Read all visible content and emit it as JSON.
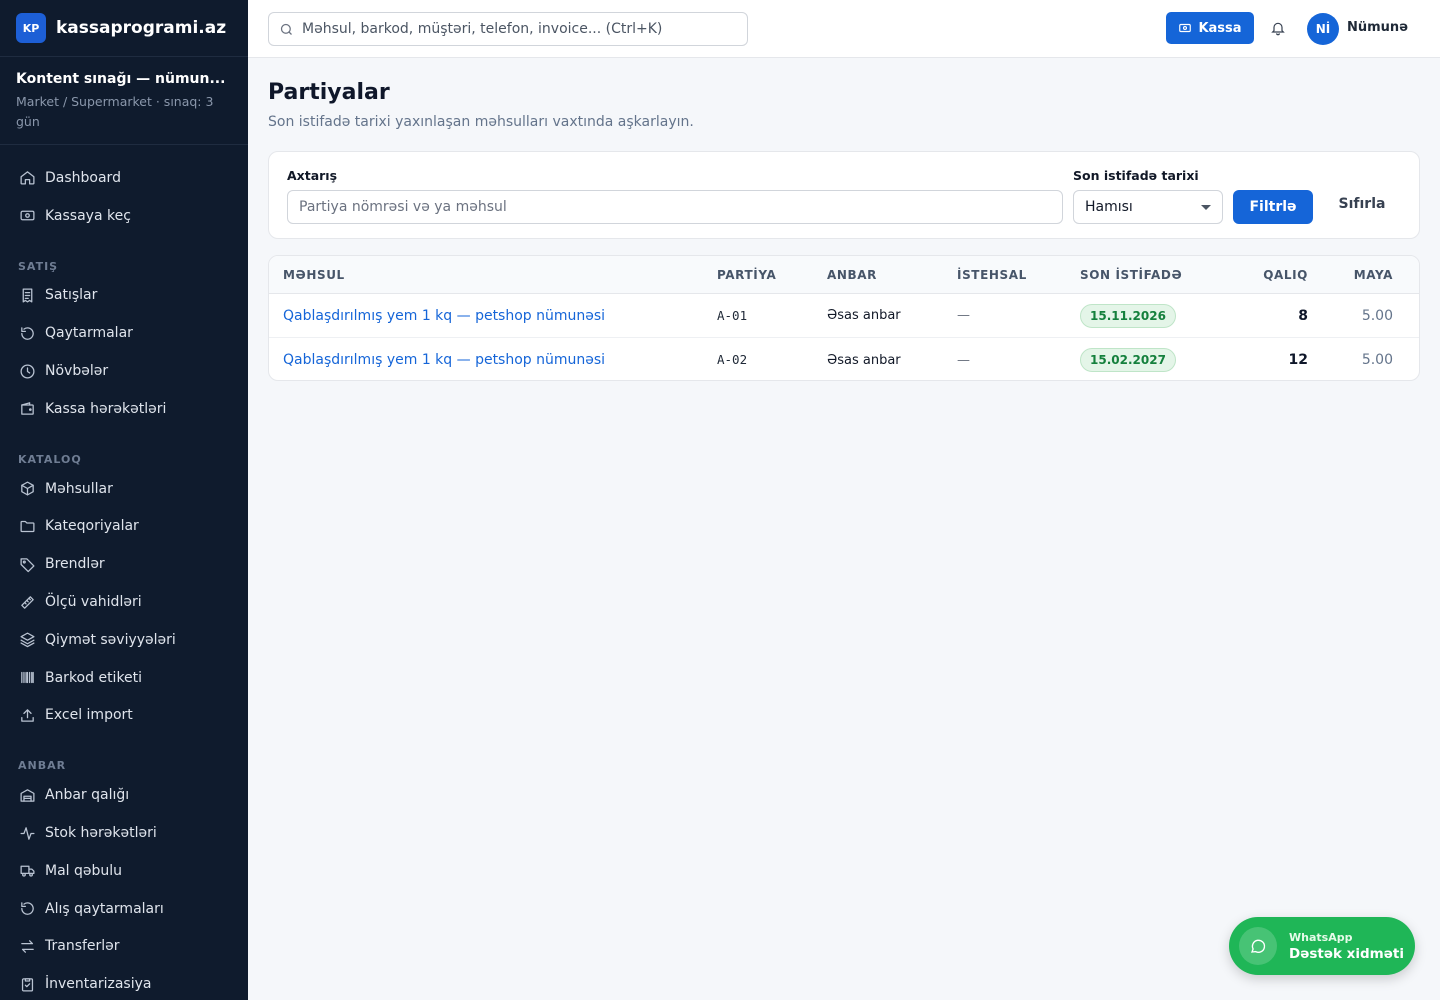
{
  "brand": {
    "logo": "KP",
    "name": "kassaprogrami.az"
  },
  "workspace": {
    "title": "Kontent sınağı — nümun...",
    "subtitle": "Market / Supermarket · sınaq: 3 gün"
  },
  "sidebar": {
    "top": [
      {
        "label": "Dashboard",
        "icon": "home-icon"
      },
      {
        "label": "Kassaya keç",
        "icon": "cash-icon"
      }
    ],
    "sections": [
      {
        "title": "SATIŞ",
        "items": [
          {
            "label": "Satışlar",
            "icon": "receipt-icon"
          },
          {
            "label": "Qaytarmalar",
            "icon": "return-icon"
          },
          {
            "label": "Növbələr",
            "icon": "clock-icon"
          },
          {
            "label": "Kassa hərəkətləri",
            "icon": "wallet-icon"
          }
        ]
      },
      {
        "title": "KATALOQ",
        "items": [
          {
            "label": "Məhsullar",
            "icon": "box-icon"
          },
          {
            "label": "Kateqoriyalar",
            "icon": "folder-icon"
          },
          {
            "label": "Brendlər",
            "icon": "tag-icon"
          },
          {
            "label": "Ölçü vahidləri",
            "icon": "ruler-icon"
          },
          {
            "label": "Qiymət səviyyələri",
            "icon": "layers-icon"
          },
          {
            "label": "Barkod etiketi",
            "icon": "barcode-icon"
          },
          {
            "label": "Excel import",
            "icon": "upload-icon"
          }
        ]
      },
      {
        "title": "ANBAR",
        "items": [
          {
            "label": "Anbar qalığı",
            "icon": "warehouse-icon"
          },
          {
            "label": "Stok hərəkətləri",
            "icon": "activity-icon"
          },
          {
            "label": "Mal qəbulu",
            "icon": "truck-icon"
          },
          {
            "label": "Alış qaytarmaları",
            "icon": "return-icon"
          },
          {
            "label": "Transferlər",
            "icon": "transfer-icon"
          },
          {
            "label": "İnventarizasiya",
            "icon": "clipboard-icon"
          }
        ]
      }
    ]
  },
  "topbar": {
    "search_placeholder": "Məhsul, barkod, müştəri, telefon, invoice... (Ctrl+K)",
    "kassa_label": "Kassa",
    "avatar": "Nİ",
    "user_name": "Nümunə"
  },
  "page": {
    "title": "Partiyalar",
    "subtitle": "Son istifadə tarixi yaxınlaşan məhsulları vaxtında aşkarlayın."
  },
  "filters": {
    "search_label": "Axtarış",
    "search_placeholder": "Partiya nömrəsi və ya məhsul",
    "expiry_label": "Son istifadə tarixi",
    "expiry_value": "Hamısı",
    "filter_button": "Filtrlə",
    "reset_button": "Sıfırla"
  },
  "table": {
    "columns": [
      "MƏHSUL",
      "PARTİYA",
      "ANBAR",
      "İSTEHSAL",
      "SON İSTİFADƏ",
      "QALIQ",
      "MAYA"
    ],
    "rows": [
      {
        "product": "Qablaşdırılmış yem 1 kq — petshop nümunəsi",
        "batch": "A-01",
        "warehouse": "Əsas anbar",
        "production": "—",
        "expiry": "15.11.2026",
        "remaining": "8",
        "cost": "5.00"
      },
      {
        "product": "Qablaşdırılmış yem 1 kq — petshop nümunəsi",
        "batch": "A-02",
        "warehouse": "Əsas anbar",
        "production": "—",
        "expiry": "15.02.2027",
        "remaining": "12",
        "cost": "5.00"
      }
    ]
  },
  "whatsapp": {
    "small": "WhatsApp",
    "big": "Dəstək xidməti"
  },
  "colors": {
    "accent": "#1565d8",
    "sidebar_bg": "#0f1b2d",
    "success": "#15803d",
    "whatsapp": "#1fb657"
  }
}
